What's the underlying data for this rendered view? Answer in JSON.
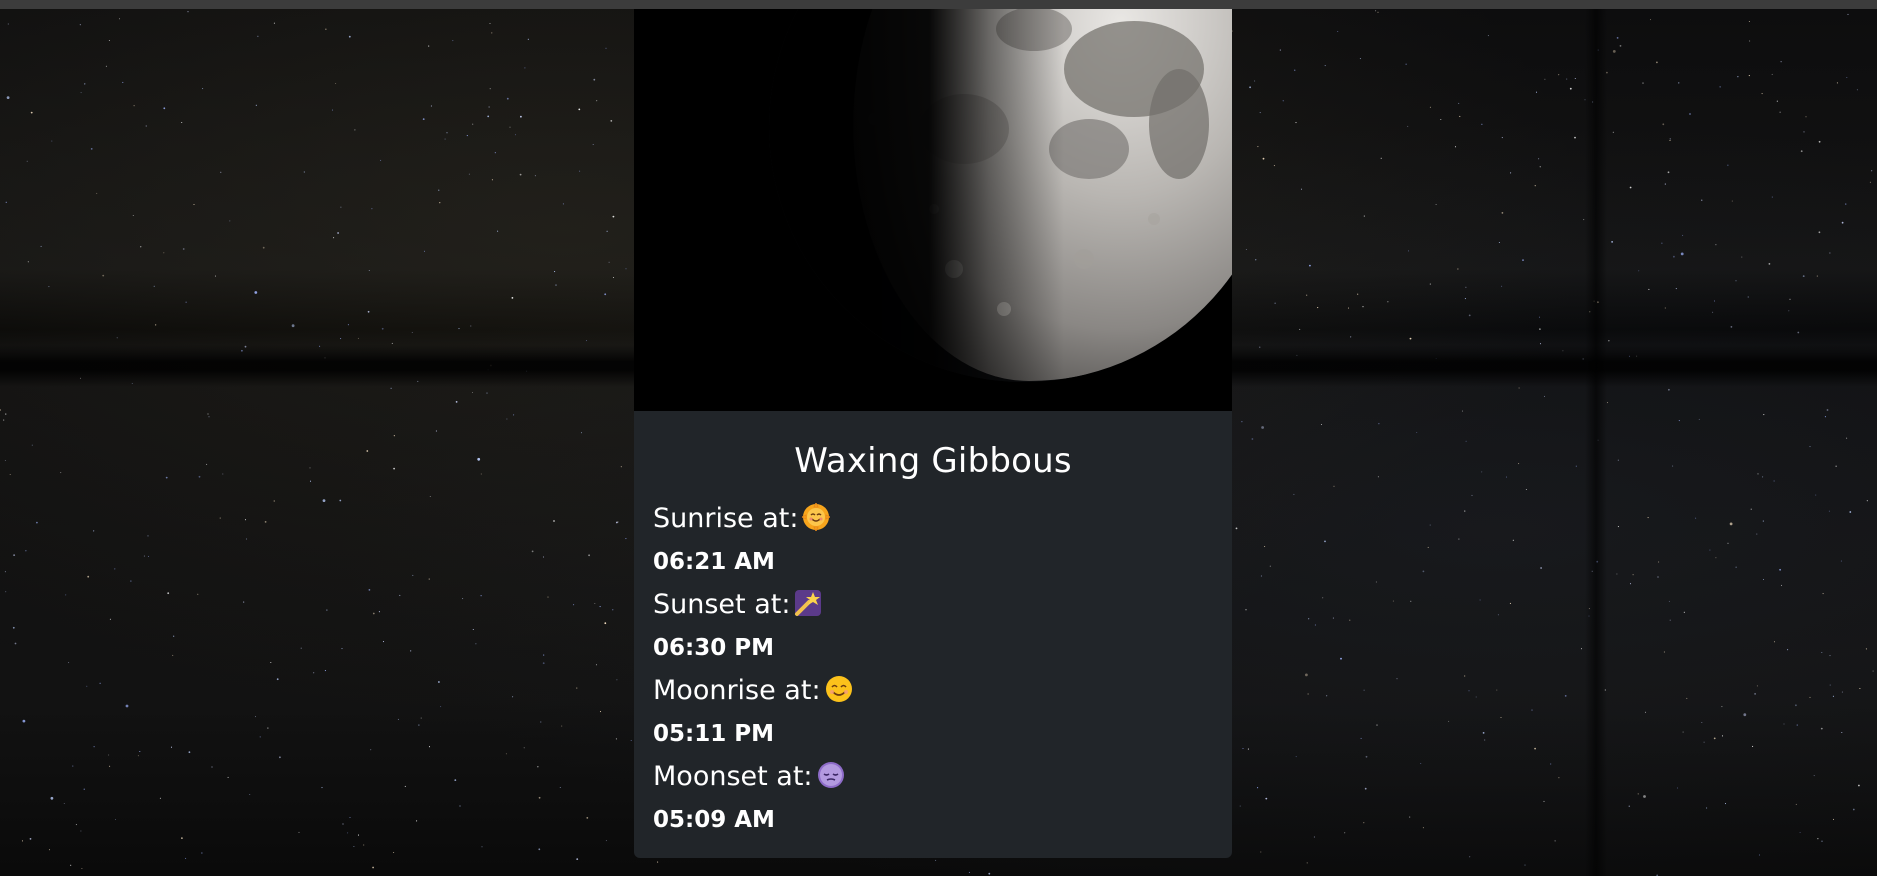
{
  "phase": {
    "name": "Waxing Gibbous",
    "image_icon": "moon-photo"
  },
  "times": [
    {
      "label": "Sunrise at:",
      "icon": "smiling-sun-icon",
      "value": "06:21 AM"
    },
    {
      "label": "Sunset at:",
      "icon": "shooting-star-icon",
      "value": "06:30 PM"
    },
    {
      "label": "Moonrise at:",
      "icon": "smiling-face-icon",
      "value": "05:11 PM"
    },
    {
      "label": "Moonset at:",
      "icon": "sleepy-face-icon",
      "value": "05:09 AM"
    }
  ],
  "colors": {
    "card_background": "#212529",
    "text": "#ffffff",
    "page_background": "#030303"
  }
}
